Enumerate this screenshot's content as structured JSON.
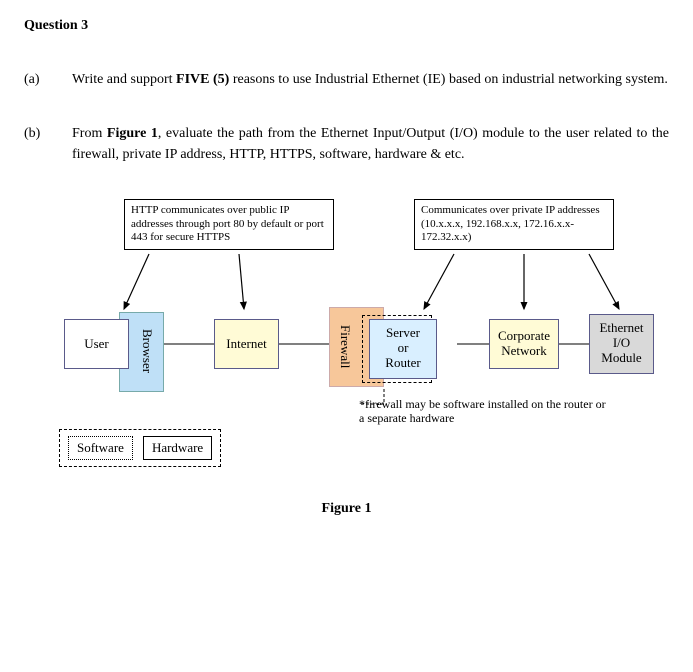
{
  "heading": "Question 3",
  "parts": {
    "a": {
      "label": "(a)",
      "text_before_bold": "Write and support ",
      "bold": "FIVE (5)",
      "text_after_bold": " reasons to use Industrial Ethernet (IE) based on industrial networking system."
    },
    "b": {
      "label": "(b)",
      "text_before_bold": "From ",
      "bold": "Figure 1",
      "text_after_bold": ", evaluate the path from the Ethernet Input/Output (I/O) module to the user related to the firewall, private IP address, HTTP, HTTPS, software, hardware & etc."
    }
  },
  "figure": {
    "note_left": "HTTP communicates over public IP addresses through port 80 by default or port 443 for secure HTTPS",
    "note_right": "Communicates over private IP addresses (10.x.x.x, 192.168.x.x, 172.16.x.x-172.32.x.x)",
    "user": "User",
    "browser": "Browser",
    "internet": "Internet",
    "firewall": "Firewall",
    "server": "Server\nor\nRouter",
    "corporate": "Corporate\nNetwork",
    "ethernet": "Ethernet\nI/O\nModule",
    "fw_note": "*firewall may be software installed on the router or a separate hardware",
    "legend_sw": "Software",
    "legend_hw": "Hardware",
    "caption": "Figure 1"
  }
}
